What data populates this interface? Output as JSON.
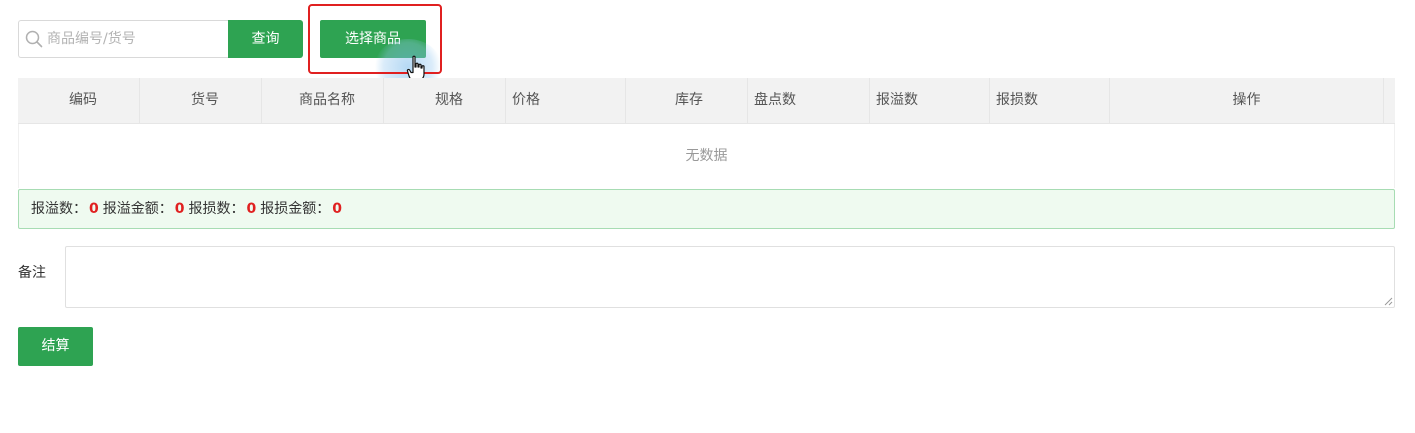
{
  "search": {
    "placeholder": "商品编号/货号",
    "query_label": "查询",
    "select_goods_label": "选择商品"
  },
  "table": {
    "columns": [
      "编码",
      "货号",
      "商品名称",
      "规格",
      "价格",
      "库存",
      "盘点数",
      "报溢数",
      "报损数",
      "操作"
    ],
    "empty_text": "无数据"
  },
  "summary": {
    "overflow_count_label": "报溢数：",
    "overflow_count": "0",
    "overflow_amount_label": "报溢金额：",
    "overflow_amount": "0",
    "loss_count_label": "报损数：",
    "loss_count": "0",
    "loss_amount_label": "报损金额：",
    "loss_amount": "0"
  },
  "remark": {
    "label": "备注",
    "value": ""
  },
  "actions": {
    "settle_label": "结算"
  },
  "colors": {
    "primary": "#2ea352",
    "highlight": "#e02020",
    "summary_bg": "#effaf0",
    "summary_border": "#a7dcb3"
  }
}
